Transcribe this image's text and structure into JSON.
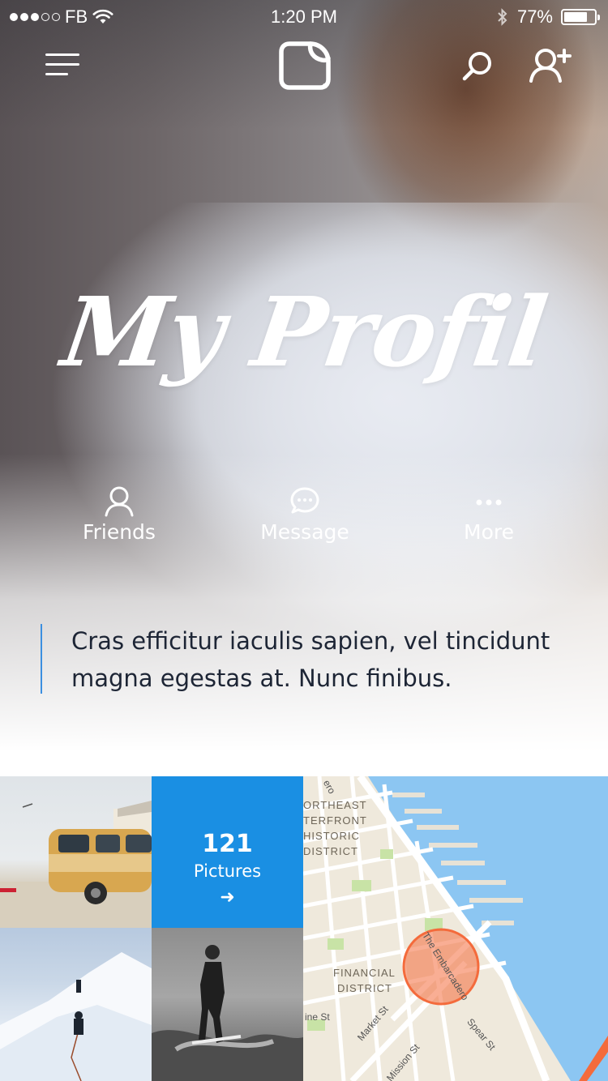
{
  "status_bar": {
    "carrier": "FB",
    "time": "1:20 PM",
    "battery_percent": "77%",
    "battery_level": 0.77
  },
  "nav": {
    "menu_icon": "hamburger-menu-icon",
    "logo_icon": "chat-bubble-logo-icon",
    "search_icon": "search-icon",
    "add_user_icon": "add-user-icon"
  },
  "title": "My Profil",
  "actions": [
    {
      "label": "Friends",
      "icon": "person-icon"
    },
    {
      "label": "Message",
      "icon": "chat-icon"
    },
    {
      "label": "More",
      "icon": "more-dots-icon"
    }
  ],
  "quote": "Cras efficitur iaculis sapien, vel tincidunt magna egestas at. Nunc finibus.",
  "pictures": {
    "count": "121",
    "label": "Pictures",
    "arrow": "➜"
  },
  "map": {
    "labels": [
      "ORTHEAST",
      "TERFRONT",
      "HISTORIC",
      "DISTRICT",
      "FINANCIAL",
      "DISTRICT"
    ],
    "streets": [
      "The Embarcadero",
      "Market St",
      "Mission St",
      "Spear St",
      "ine St",
      "ero"
    ]
  },
  "colors": {
    "accent_blue": "#1a8fe3",
    "quote_bar": "#3b8fe0",
    "map_marker": "#f46b3c",
    "map_water": "#8cc6f2"
  }
}
